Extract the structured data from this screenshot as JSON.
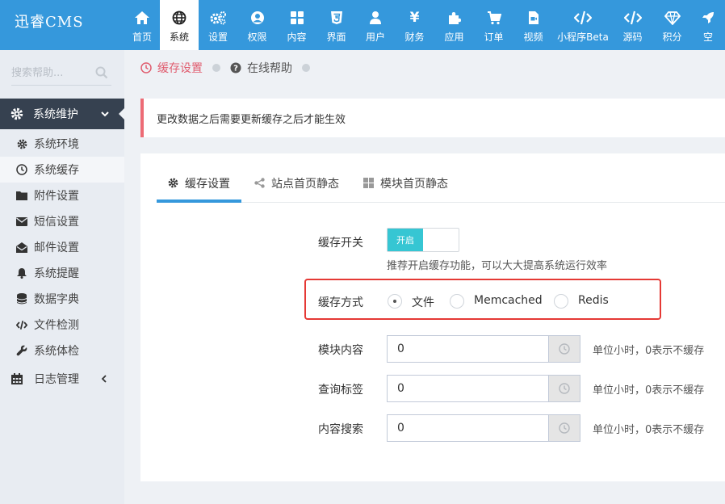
{
  "app": {
    "title": "迅睿CMS"
  },
  "nav": [
    {
      "label": "首页",
      "icon": "home-icon"
    },
    {
      "label": "系统",
      "icon": "globe-icon"
    },
    {
      "label": "设置",
      "icon": "cogs-icon"
    },
    {
      "label": "权限",
      "icon": "user-circle-icon"
    },
    {
      "label": "内容",
      "icon": "grid-icon"
    },
    {
      "label": "界面",
      "icon": "html5-icon"
    },
    {
      "label": "用户",
      "icon": "user-icon"
    },
    {
      "label": "财务",
      "icon": "yen-icon"
    },
    {
      "label": "应用",
      "icon": "puzzle-icon"
    },
    {
      "label": "订单",
      "icon": "cart-icon"
    },
    {
      "label": "视频",
      "icon": "video-file-icon"
    },
    {
      "label": "小程序Beta",
      "icon": "code-icon"
    },
    {
      "label": "源码",
      "icon": "code-icon"
    },
    {
      "label": "积分",
      "icon": "diamond-icon"
    },
    {
      "label": "空",
      "icon": "rocket-icon"
    }
  ],
  "sidebar": {
    "search_placeholder": "搜索帮助...",
    "group_active": "系统维护",
    "items": [
      {
        "label": "系统环境",
        "icon": "cog-icon"
      },
      {
        "label": "系统缓存",
        "icon": "clock-icon"
      },
      {
        "label": "附件设置",
        "icon": "folder-icon"
      },
      {
        "label": "短信设置",
        "icon": "envelope-icon"
      },
      {
        "label": "邮件设置",
        "icon": "envelope-open-icon"
      },
      {
        "label": "系统提醒",
        "icon": "bell-icon"
      },
      {
        "label": "数据字典",
        "icon": "database-icon"
      },
      {
        "label": "文件检测",
        "icon": "code-icon"
      },
      {
        "label": "系统体检",
        "icon": "wrench-icon"
      }
    ],
    "group2": "日志管理"
  },
  "breadcrumb": {
    "item1": "缓存设置",
    "item2": "在线帮助"
  },
  "notice": "更改数据之后需要更新缓存之后才能生效",
  "tabs": [
    {
      "label": "缓存设置",
      "icon": "cog-icon"
    },
    {
      "label": "站点首页静态",
      "icon": "share-icon"
    },
    {
      "label": "模块首页静态",
      "icon": "grid-icon"
    }
  ],
  "form": {
    "cache_switch_label": "缓存开关",
    "switch_on_text": "开启",
    "switch_hint": "推荐开启缓存功能，可以大大提高系统运行效率",
    "cache_mode_label": "缓存方式",
    "cache_mode_options": [
      "文件",
      "Memcached",
      "Redis"
    ],
    "cache_mode_selected": "文件",
    "fields": [
      {
        "label": "模块内容",
        "value": "0",
        "unit": "单位小时，0表示不缓存"
      },
      {
        "label": "查询标签",
        "value": "0",
        "unit": "单位小时，0表示不缓存"
      },
      {
        "label": "内容搜索",
        "value": "0",
        "unit": "单位小时，0表示不缓存"
      }
    ]
  },
  "colors": {
    "header": "#3598dc",
    "sidebar_active": "#364150",
    "accent_red": "#e05d6f",
    "switch_on": "#36c6d3"
  }
}
